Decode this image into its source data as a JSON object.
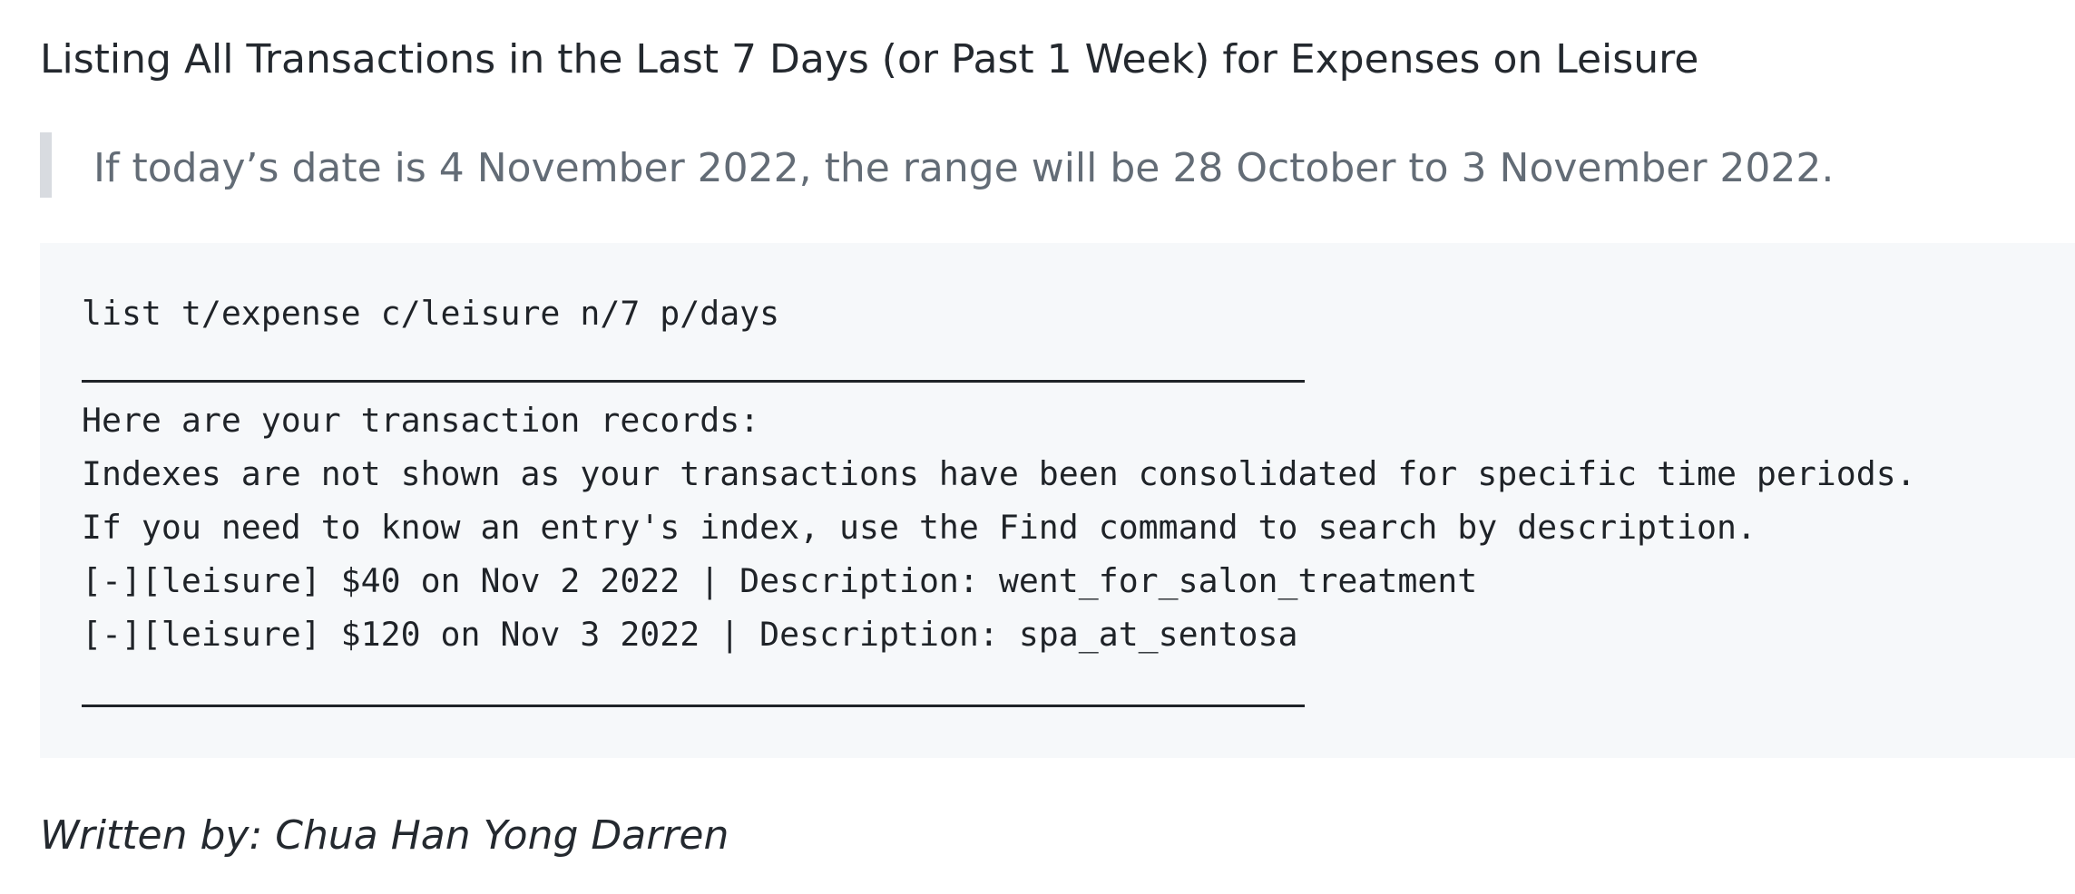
{
  "heading": "Listing All Transactions in the Last 7 Days (or Past 1 Week) for Expenses on Leisure",
  "note": "If today’s date is 4 November 2022, the range will be 28 October to 3 November 2022.",
  "code": {
    "command": "list t/expense c/leisure n/7 p/days",
    "separator": "____________________________________________________________",
    "lines": [
      "Here are your transaction records:",
      "Indexes are not shown as your transactions have been consolidated for specific time periods.",
      "If you need to know an entry's index, use the Find command to search by description.",
      "[-][leisure] $40 on Nov 2 2022 | Description: went_for_salon_treatment",
      "[-][leisure] $120 on Nov 3 2022 | Description: spa_at_sentosa"
    ]
  },
  "author": "Written by: Chua Han Yong Darren"
}
